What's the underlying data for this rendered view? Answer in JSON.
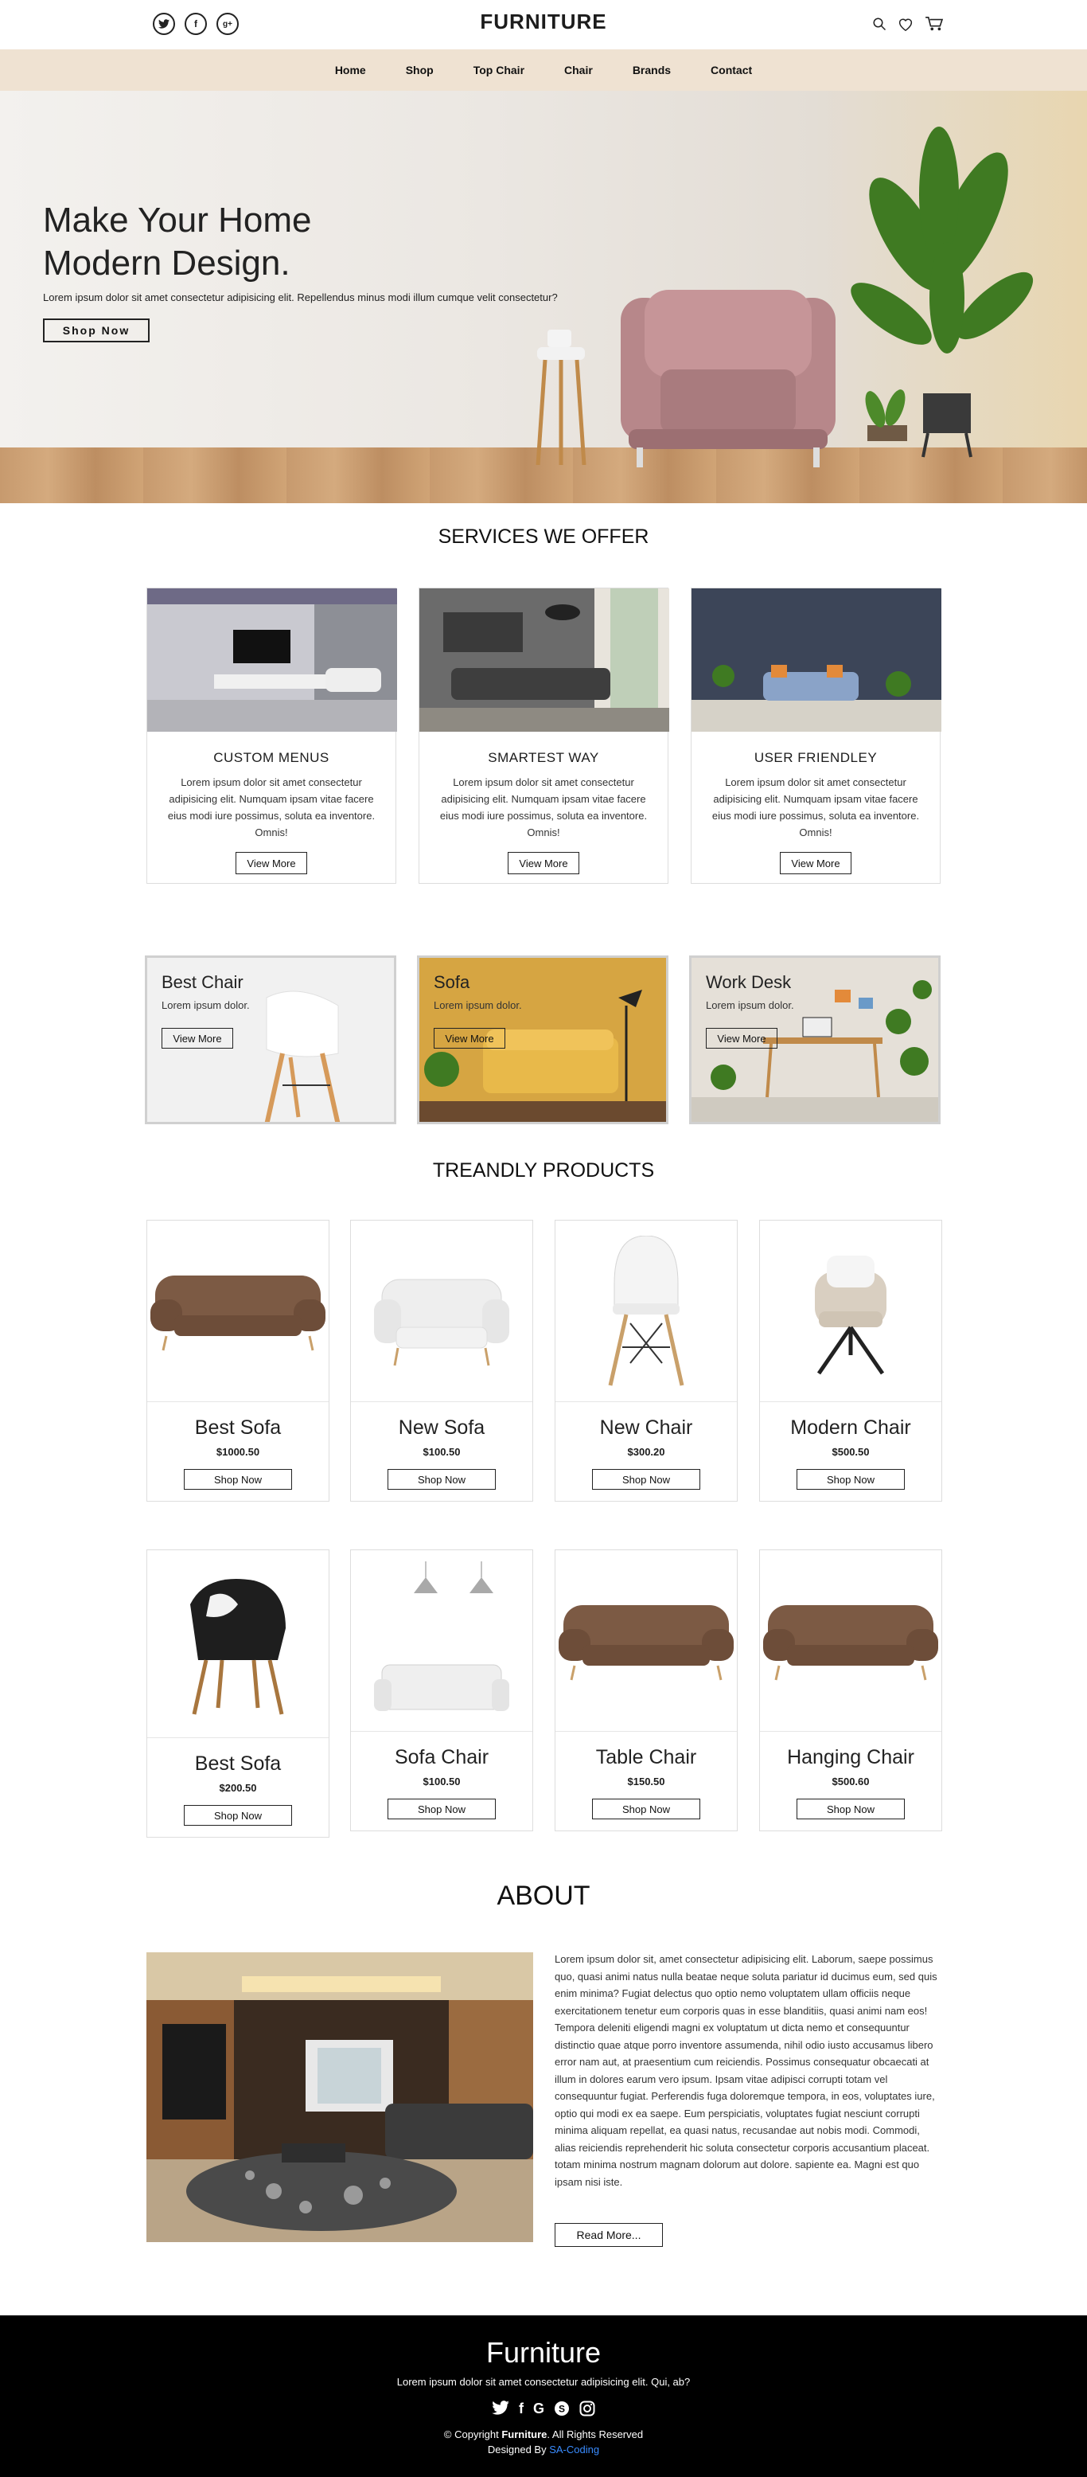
{
  "header": {
    "brand": "FURNITURE",
    "social": [
      "twitter-icon",
      "facebook-icon",
      "google-plus-icon"
    ],
    "nav": [
      "Home",
      "Shop",
      "Top Chair",
      "Chair",
      "Brands",
      "Contact"
    ]
  },
  "hero": {
    "title_line1": "Make Your Home",
    "title_line2": "Modern Design.",
    "subtitle": "Lorem ipsum dolor sit amet consectetur adipisicing elit. Repellendus minus modi illum cumque velit consectetur?",
    "cta": "Shop Now"
  },
  "services": {
    "title": "SERVICES WE OFFER",
    "items": [
      {
        "title": "CUSTOM MENUS",
        "text": "Lorem ipsum dolor sit amet consectetur adipisicing elit. Numquam ipsam vitae facere eius modi iure possimus, soluta ea inventore. Omnis!",
        "button": "View More"
      },
      {
        "title": "SMARTEST WAY",
        "text": "Lorem ipsum dolor sit amet consectetur adipisicing elit. Numquam ipsam vitae facere eius modi iure possimus, soluta ea inventore. Omnis!",
        "button": "View More"
      },
      {
        "title": "USER FRIENDLEY",
        "text": "Lorem ipsum dolor sit amet consectetur adipisicing elit. Numquam ipsam vitae facere eius modi iure possimus, soluta ea inventore. Omnis!",
        "button": "View More"
      }
    ]
  },
  "categories": [
    {
      "title": "Best Chair",
      "text": "Lorem ipsum dolor.",
      "button": "View More"
    },
    {
      "title": "Sofa",
      "text": "Lorem ipsum dolor.",
      "button": "View More"
    },
    {
      "title": "Work Desk",
      "text": "Lorem ipsum dolor.",
      "button": "View More"
    }
  ],
  "products": {
    "title": "TREANDLY PRODUCTS",
    "items": [
      {
        "name": "Best Sofa",
        "price": "$1000.50",
        "button": "Shop Now"
      },
      {
        "name": "New Sofa",
        "price": "$100.50",
        "button": "Shop Now"
      },
      {
        "name": "New Chair",
        "price": "$300.20",
        "button": "Shop Now"
      },
      {
        "name": "Modern Chair",
        "price": "$500.50",
        "button": "Shop Now"
      },
      {
        "name": "Best Sofa",
        "price": "$200.50",
        "button": "Shop Now"
      },
      {
        "name": "Sofa Chair",
        "price": "$100.50",
        "button": "Shop Now"
      },
      {
        "name": "Table Chair",
        "price": "$150.50",
        "button": "Shop Now"
      },
      {
        "name": "Hanging Chair",
        "price": "$500.60",
        "button": "Shop Now"
      }
    ]
  },
  "about": {
    "title": "ABOUT",
    "text": "Lorem ipsum dolor sit, amet consectetur adipisicing elit. Laborum, saepe possimus quo, quasi animi natus nulla beatae neque soluta pariatur id ducimus eum, sed quis enim minima? Fugiat delectus quo optio nemo voluptatem ullam officiis neque exercitationem tenetur eum corporis quas in esse blanditiis, quasi animi nam eos! Tempora deleniti eligendi magni ex voluptatum ut dicta nemo et consequuntur distinctio quae atque porro inventore assumenda, nihil odio iusto accusamus libero error nam aut, at praesentium cum reiciendis. Possimus consequatur obcaecati at illum in dolores earum vero ipsum. Ipsam vitae adipisci corrupti totam vel consequuntur fugiat. Perferendis fuga doloremque tempora, in eos, voluptates iure, optio qui modi ex ea saepe. Eum perspiciatis, voluptates fugiat nesciunt corrupti minima aliquam repellat, ea quasi natus, recusandae aut nobis modi. Commodi, alias reiciendis reprehenderit hic soluta consectetur corporis accusantium placeat. totam minima nostrum magnam dolorum aut dolore. sapiente ea. Magni est quo ipsam nisi iste.",
    "button": "Read More..."
  },
  "footer": {
    "title": "Furniture",
    "desc": "Lorem ipsum dolor sit amet consectetur adipisicing elit. Qui, ab?",
    "social": [
      "twitter-icon",
      "facebook-icon",
      "google-icon",
      "skype-icon",
      "instagram-icon"
    ],
    "copy_prefix": "© Copyright ",
    "copy_brand": "Furniture",
    "copy_suffix": ". All Rights Reserved",
    "designed_prefix": "Designed By ",
    "designer": "SA-Coding"
  },
  "colors": {
    "nav_bg": "#efe2d2",
    "footer_bg": "#000000",
    "link": "#3a8cff"
  }
}
